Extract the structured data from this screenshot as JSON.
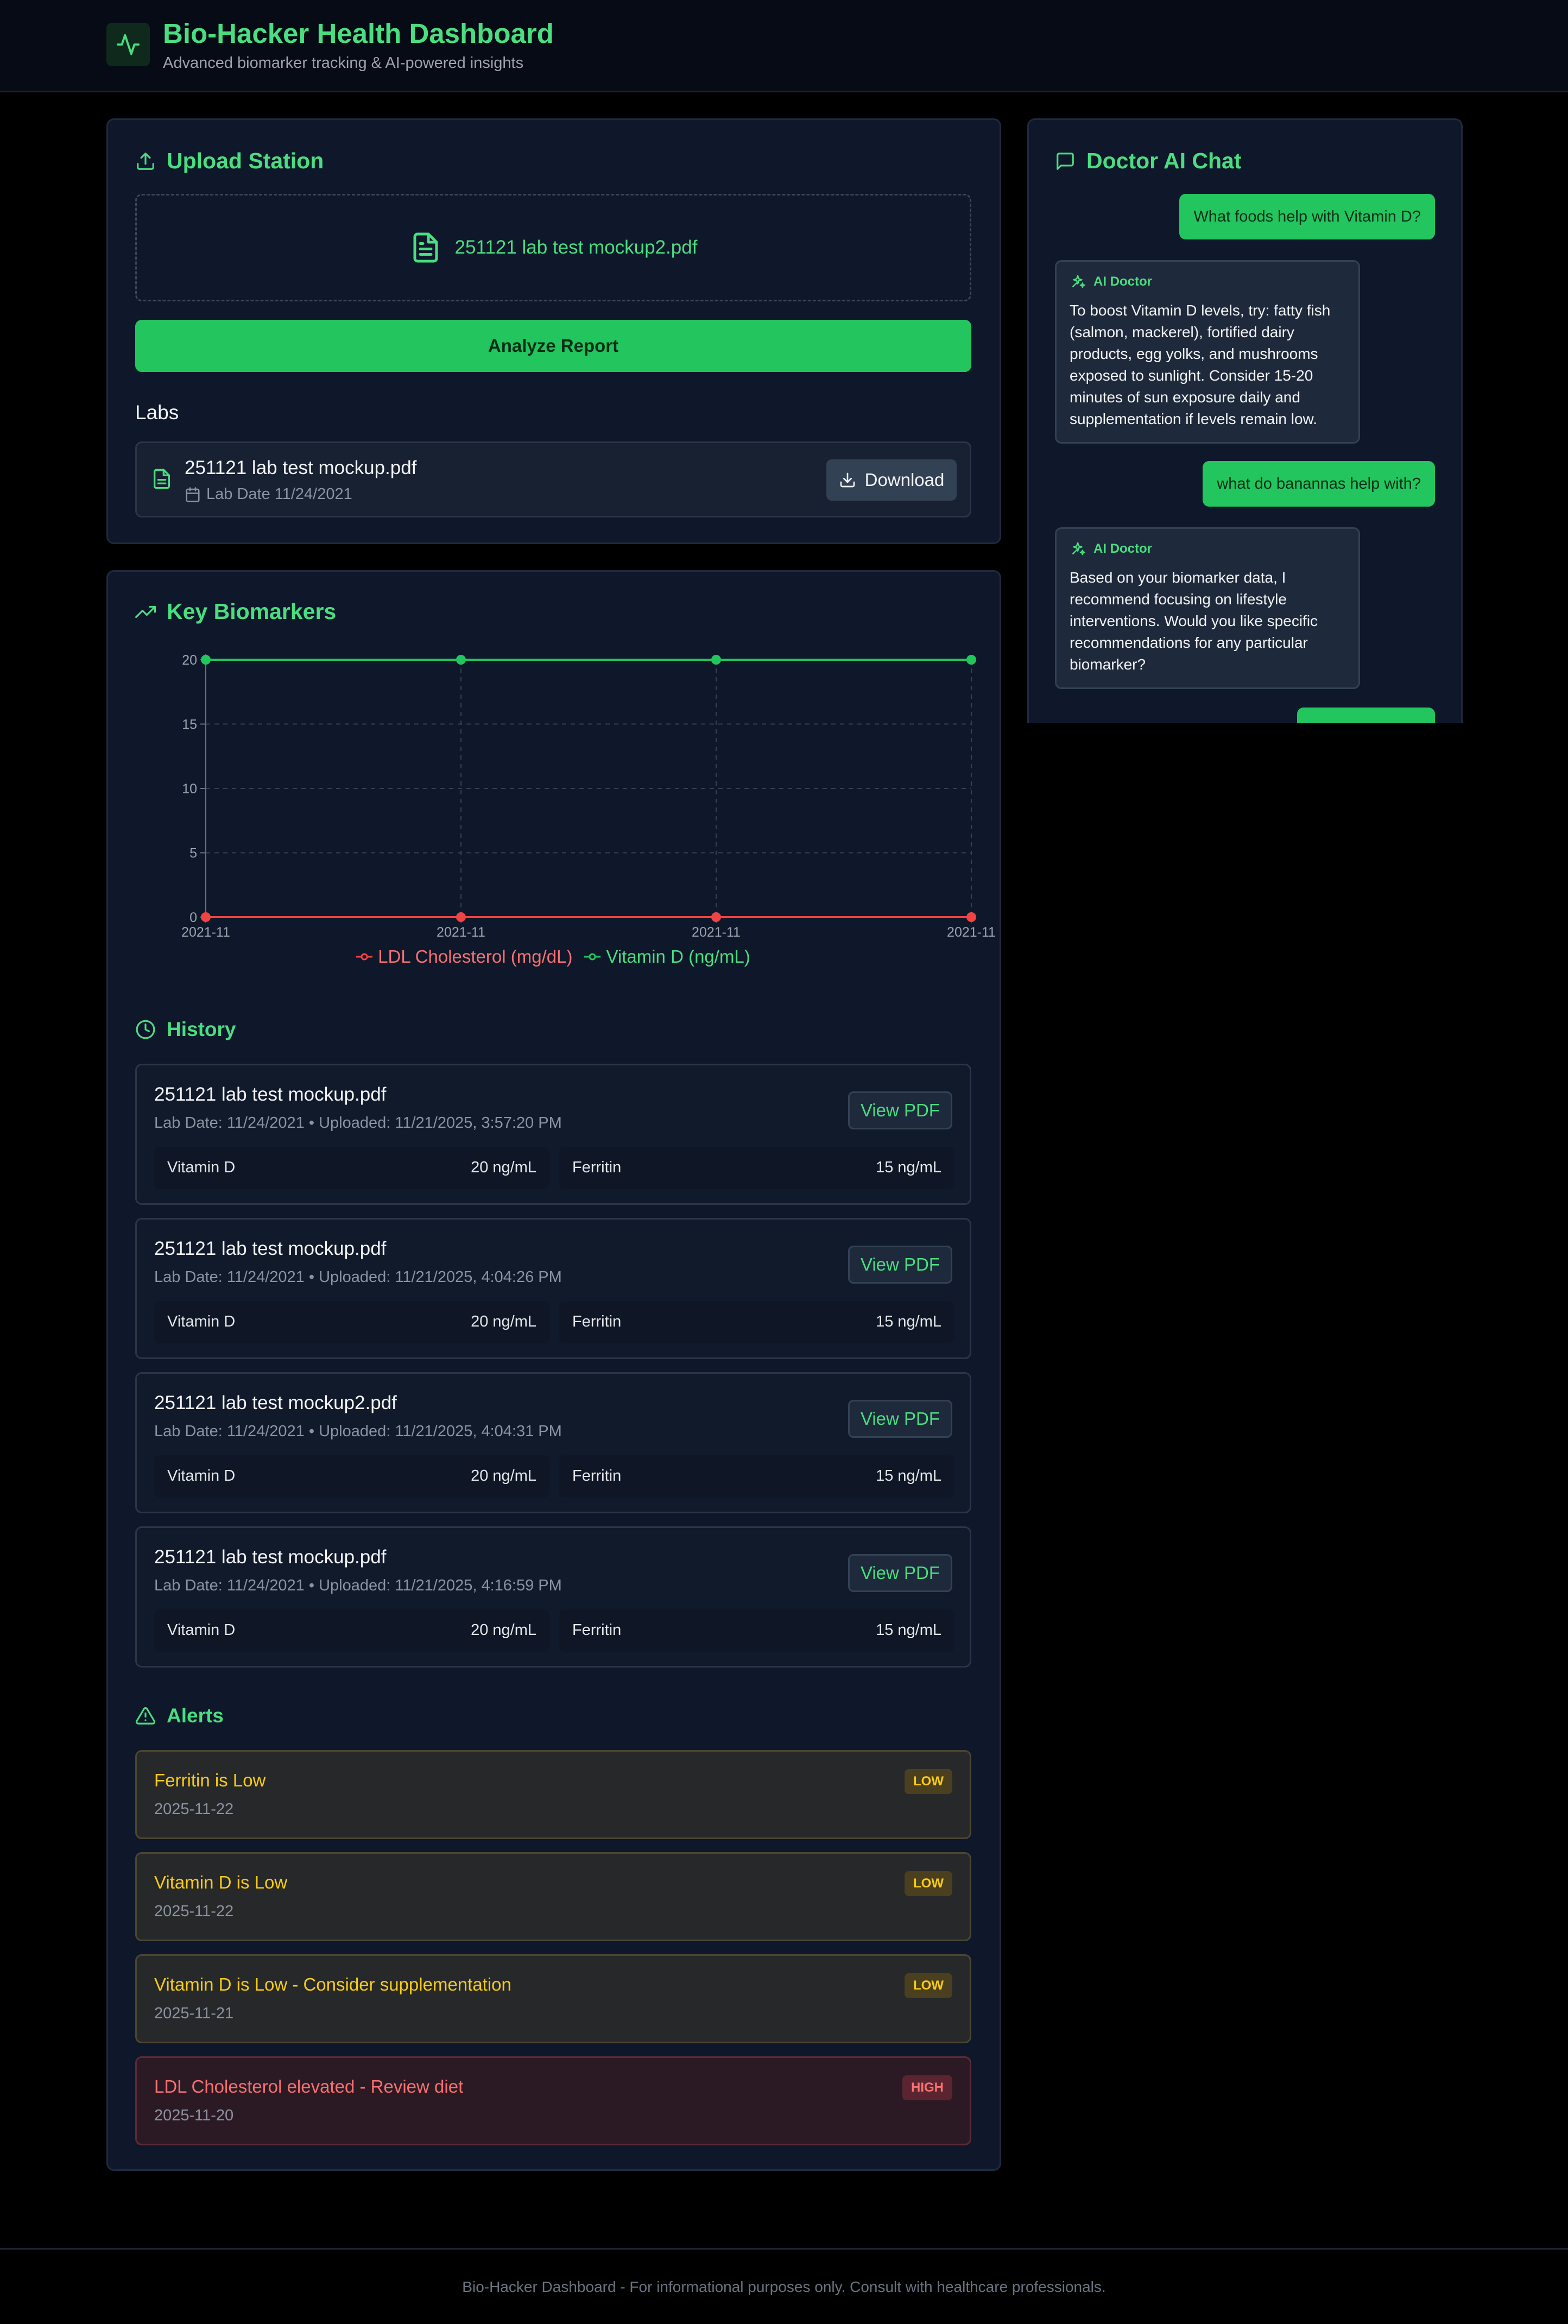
{
  "header": {
    "title": "Bio-Hacker Health Dashboard",
    "subtitle": "Advanced biomarker tracking & AI-powered insights",
    "logo_icon": "activity-pulse-icon"
  },
  "upload": {
    "title": "Upload Station",
    "selected_file": "251121 lab test mockup2.pdf",
    "analyze_label": "Analyze Report",
    "labs_heading": "Labs",
    "labs": [
      {
        "name": "251121 lab test mockup.pdf",
        "date": "Lab Date 11/24/2021",
        "download_label": "Download"
      }
    ]
  },
  "biomarkers": {
    "title": "Key Biomarkers"
  },
  "chart_data": {
    "type": "line",
    "title": "",
    "x": [
      "2021-11",
      "2021-11",
      "2021-11",
      "2021-11"
    ],
    "series": [
      {
        "name": "LDL Cholesterol (mg/dL)",
        "values": [
          0,
          0,
          0,
          0
        ],
        "color": "#ef4444"
      },
      {
        "name": "Vitamin D (ng/mL)",
        "values": [
          20,
          20,
          20,
          20
        ],
        "color": "#22c55e"
      }
    ],
    "ylim": [
      0,
      20
    ],
    "yticks": [
      "0",
      "5",
      "10",
      "15",
      "20"
    ],
    "grid": true,
    "legend": "bottom-center"
  },
  "history": {
    "title": "History",
    "view_label": "View PDF",
    "items": [
      {
        "name": "251121 lab test mockup.pdf",
        "meta": "Lab Date: 11/24/2021 • Uploaded: 11/21/2025, 3:57:20 PM",
        "metrics": [
          {
            "name": "Vitamin D",
            "value": "20 ng/mL"
          },
          {
            "name": "Ferritin",
            "value": "15 ng/mL"
          }
        ]
      },
      {
        "name": "251121 lab test mockup.pdf",
        "meta": "Lab Date: 11/24/2021 • Uploaded: 11/21/2025, 4:04:26 PM",
        "metrics": [
          {
            "name": "Vitamin D",
            "value": "20 ng/mL"
          },
          {
            "name": "Ferritin",
            "value": "15 ng/mL"
          }
        ]
      },
      {
        "name": "251121 lab test mockup2.pdf",
        "meta": "Lab Date: 11/24/2021 • Uploaded: 11/21/2025, 4:04:31 PM",
        "metrics": [
          {
            "name": "Vitamin D",
            "value": "20 ng/mL"
          },
          {
            "name": "Ferritin",
            "value": "15 ng/mL"
          }
        ]
      },
      {
        "name": "251121 lab test mockup.pdf",
        "meta": "Lab Date: 11/24/2021 • Uploaded: 11/21/2025, 4:16:59 PM",
        "metrics": [
          {
            "name": "Vitamin D",
            "value": "20 ng/mL"
          },
          {
            "name": "Ferritin",
            "value": "15 ng/mL"
          }
        ]
      }
    ]
  },
  "alerts": {
    "title": "Alerts",
    "items": [
      {
        "title": "Ferritin is Low",
        "date": "2025-11-22",
        "level": "LOW"
      },
      {
        "title": "Vitamin D is Low",
        "date": "2025-11-22",
        "level": "LOW"
      },
      {
        "title": "Vitamin D is Low - Consider supplementation",
        "date": "2025-11-21",
        "level": "LOW"
      },
      {
        "title": "LDL Cholesterol elevated - Review diet",
        "date": "2025-11-20",
        "level": "HIGH"
      }
    ]
  },
  "chat": {
    "title": "Doctor AI Chat",
    "ai_label": "AI Doctor",
    "messages": [
      {
        "role": "user",
        "text": "What foods help with Vitamin D?"
      },
      {
        "role": "ai",
        "text": "To boost Vitamin D levels, try: fatty fish (salmon, mackerel), fortified dairy products, egg yolks, and mushrooms exposed to sunlight. Consider 15-20 minutes of sun exposure daily and supplementation if levels remain low."
      },
      {
        "role": "user",
        "text": "what do banannas help with?"
      },
      {
        "role": "ai",
        "text": "Based on your biomarker data, I recommend focusing on lifestyle interventions. Would you like specific recommendations for any particular biomarker?"
      },
      {
        "role": "user",
        "text": ""
      }
    ]
  },
  "footer": {
    "text": "Bio-Hacker Dashboard - For informational purposes only. Consult with healthcare professionals."
  }
}
